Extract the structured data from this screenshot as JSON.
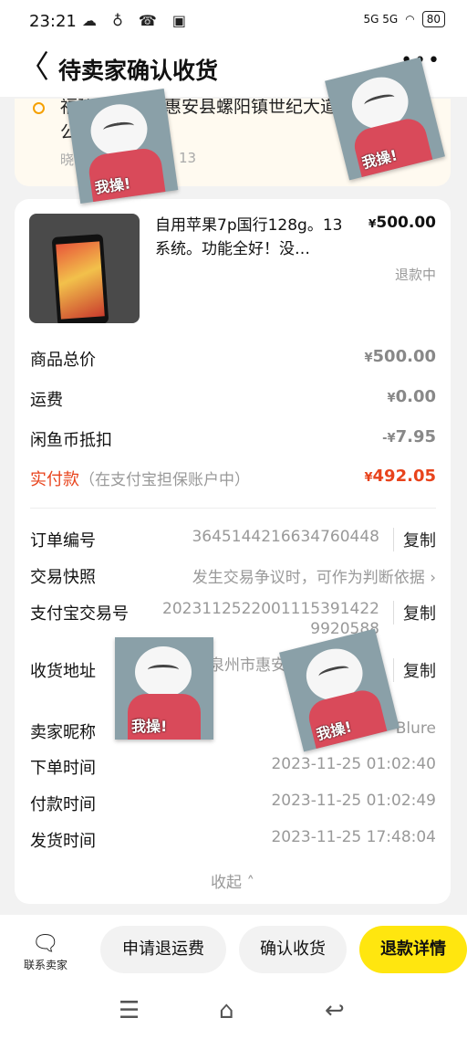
{
  "status": {
    "time": "23:21",
    "icons": "☁ ♁ ☎ ▣",
    "signal": "5G 5G",
    "battery": "80"
  },
  "nav": {
    "back": "〈",
    "title": "待卖家确认收货",
    "more": "•••"
  },
  "address_card": {
    "line": "福建省泉州市惠安县螺阳镇世纪大道世纪",
    "line2": "公",
    "sub": "晓",
    "sub_tail": "13"
  },
  "product": {
    "title": "自用苹果7p国行128g。13系统。功能全好！没…",
    "price": "500.00",
    "currency": "¥",
    "status": "退款中"
  },
  "summary": [
    {
      "label": "商品总价",
      "currency": "¥",
      "value": "500.00"
    },
    {
      "label": "运费",
      "currency": "¥",
      "value": "0.00"
    },
    {
      "label": "闲鱼币抵扣",
      "currency": "-¥",
      "value": "7.95"
    }
  ],
  "paid": {
    "label": "实付款",
    "note": "（在支付宝担保账户中）",
    "currency": "¥",
    "value": "492.05"
  },
  "details": {
    "order_no": {
      "label": "订单编号",
      "value": "3645144216634760448",
      "action": "复制"
    },
    "snapshot": {
      "label": "交易快照",
      "value": "发生交易争议时，可作为判断依据 ›"
    },
    "alipay_no": {
      "label": "支付宝交易号",
      "value": "20231125220011153914229920588",
      "action": "复制"
    },
    "address": {
      "label": "收货地址",
      "value": "福建省泉州市惠安县螺阳镇世纪大道世纪",
      "action": "复制"
    },
    "seller": {
      "label": "卖家昵称",
      "value": "Blure"
    },
    "order_time": {
      "label": "下单时间",
      "value": "2023-11-25 01:02:40"
    },
    "pay_time": {
      "label": "付款时间",
      "value": "2023-11-25 01:02:49"
    },
    "ship_time": {
      "label": "发货时间",
      "value": "2023-11-25 17:48:04"
    }
  },
  "collapse": "收起 ˄",
  "bottom": {
    "contact": "联系卖家",
    "refund_shipping": "申请退运费",
    "confirm": "确认收货",
    "refund_detail": "退款详情"
  },
  "meme_text": "我操!",
  "colors": {
    "accent_yellow": "#ffe60f",
    "price_red": "#e8431c"
  }
}
